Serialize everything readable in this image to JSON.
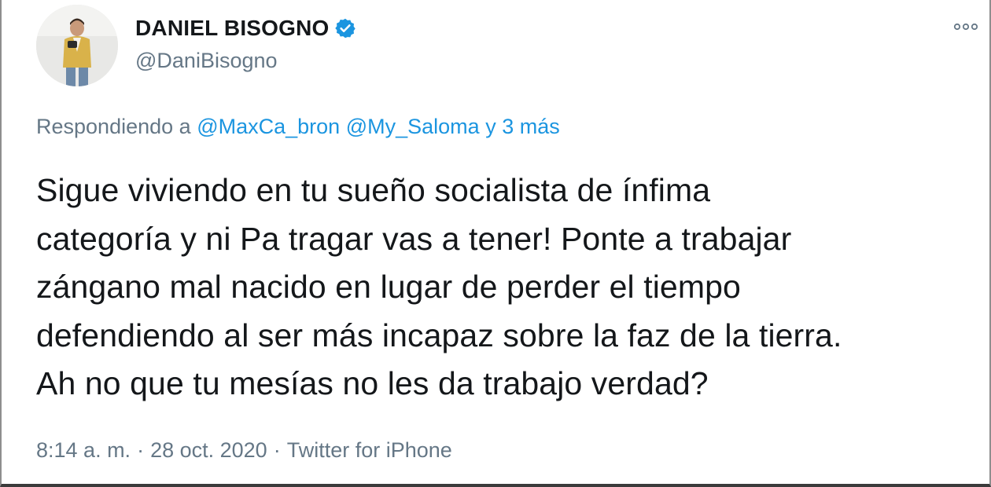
{
  "author": {
    "display_name": "DANIEL BISOGNO",
    "handle": "@DaniBisogno",
    "verified": true
  },
  "reply": {
    "prefix": "Respondiendo a",
    "mentions": [
      "@MaxCa_bron",
      "@My_Saloma"
    ],
    "others": "y 3 más"
  },
  "tweet": {
    "lines": [
      "Sigue viviendo en tu sueño socialista de ínfima",
      "categoría y ni Pa tragar vas a tener! Ponte a trabajar",
      "zángano mal nacido en lugar de perder el tiempo",
      "defendiendo al ser más incapaz sobre la faz de la tierra.",
      "Ah no que tu mesías no les da trabajo verdad?"
    ]
  },
  "meta": {
    "time": "8:14 a. m.",
    "date": "28 oct. 2020",
    "source": "Twitter for iPhone",
    "separator": "·"
  },
  "icons": {
    "verified": "verified-badge-icon",
    "more": "more-options-icon"
  },
  "colors": {
    "accent": "#1b95e0",
    "muted": "#657786",
    "text": "#14171a"
  }
}
